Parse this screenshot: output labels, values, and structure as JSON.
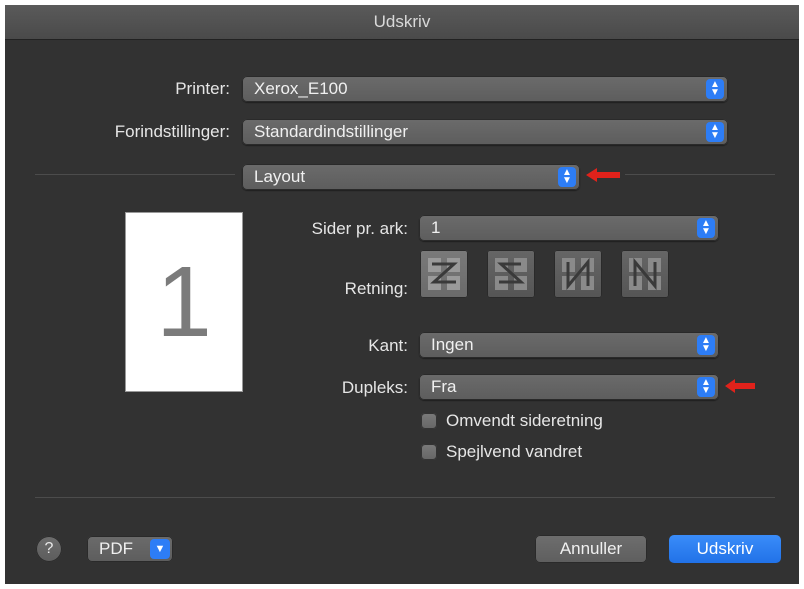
{
  "window": {
    "title": "Udskriv"
  },
  "printer": {
    "label": "Printer:",
    "value": "Xerox_E100"
  },
  "presets": {
    "label": "Forindstillinger:",
    "value": "Standardindstillinger"
  },
  "section": {
    "value": "Layout"
  },
  "preview": {
    "page_number": "1"
  },
  "pages_per_sheet": {
    "label": "Sider pr. ark:",
    "value": "1"
  },
  "orientation": {
    "label": "Retning:",
    "options": [
      "layout-direction-z-icon",
      "layout-direction-s-icon",
      "layout-direction-n-icon",
      "layout-direction-reverse-n-icon"
    ],
    "selected_index": 0
  },
  "border": {
    "label": "Kant:",
    "value": "Ingen"
  },
  "duplex": {
    "label": "Dupleks:",
    "value": "Fra"
  },
  "checkboxes": [
    {
      "label": "Omvendt sideretning",
      "checked": false
    },
    {
      "label": "Spejlvend vandret",
      "checked": false
    }
  ],
  "footer": {
    "help": "?",
    "pdf": "PDF",
    "cancel": "Annuller",
    "print": "Udskriv"
  },
  "colors": {
    "accent": "#2d7df6",
    "annotation_arrow": "#e0221b"
  }
}
